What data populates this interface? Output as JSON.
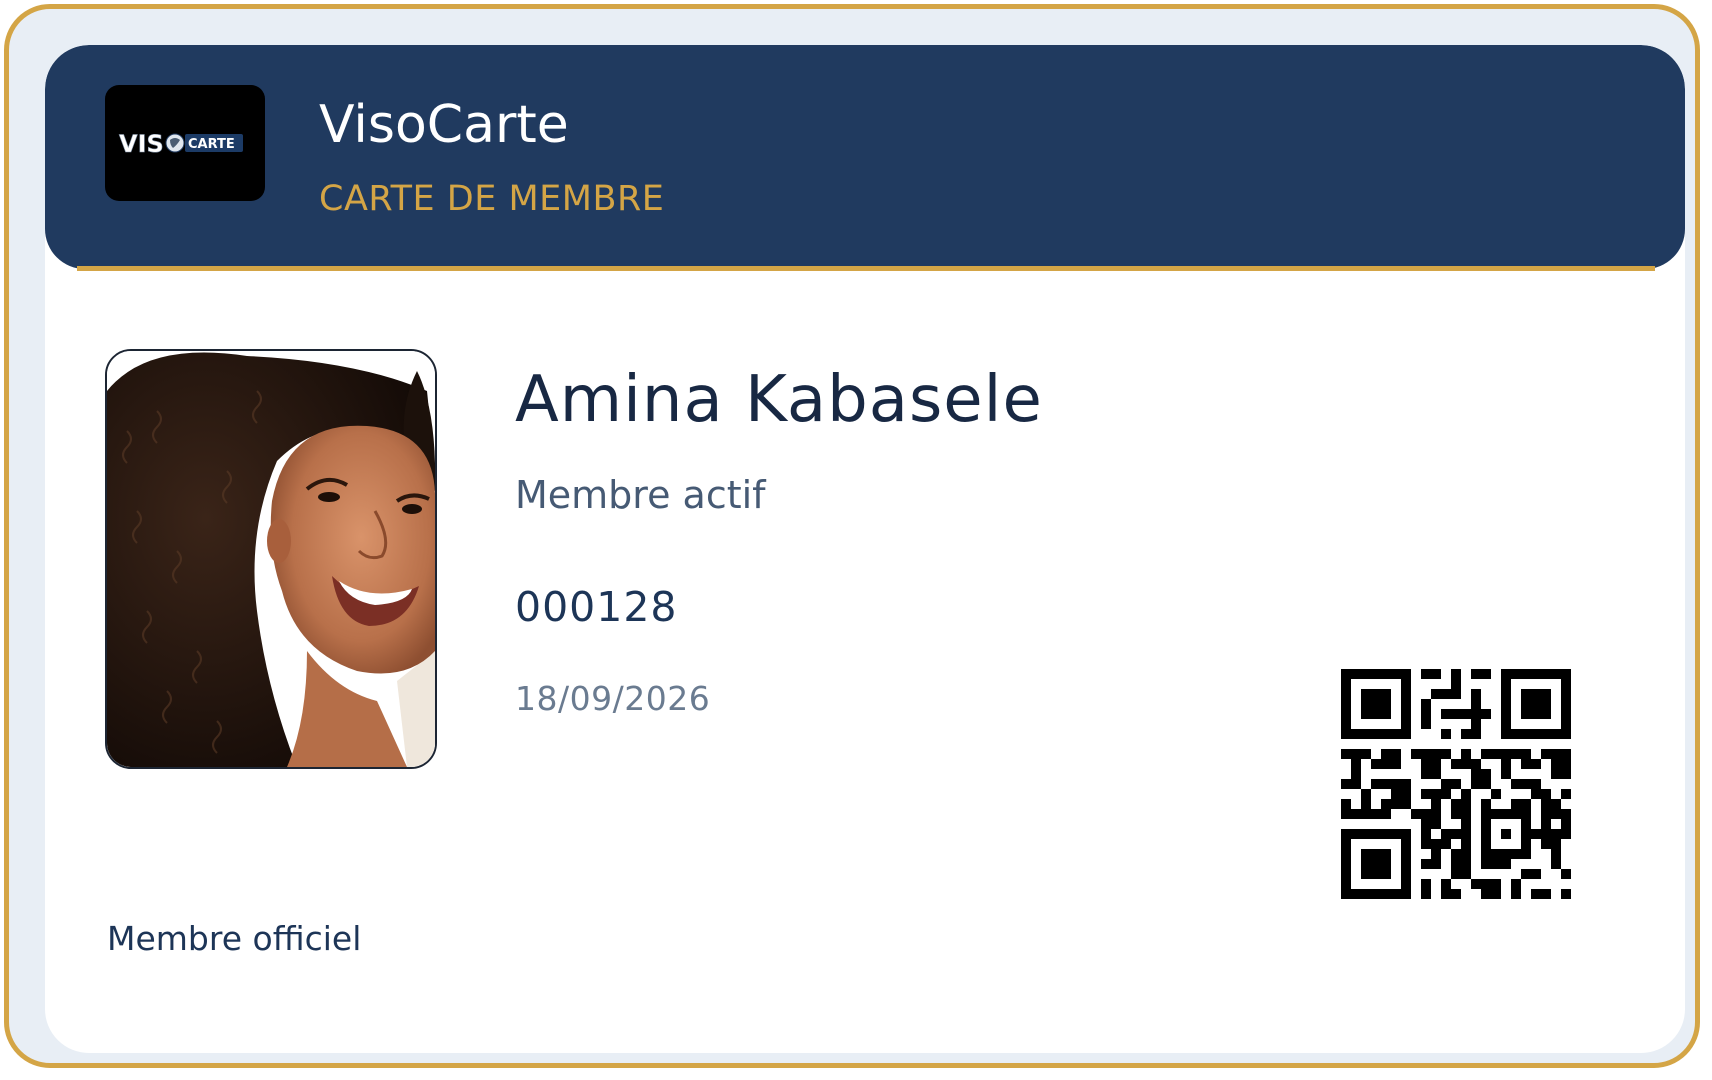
{
  "colors": {
    "accent_gold": "#d4a546",
    "header_navy": "#203a5f",
    "text_dark": "#182843",
    "text_muted": "#6a7b90",
    "frame_bg": "#e8eef5"
  },
  "header": {
    "logo": {
      "icon": "visocarte-logo-icon",
      "text_left": "VIS",
      "text_right": "CARTE"
    },
    "title": "VisoCarte",
    "subtitle": "CARTE DE MEMBRE"
  },
  "member": {
    "photo_icon": "member-portrait-photo",
    "name": "Amina Kabasele",
    "role": "Membre actif",
    "number": "000128",
    "date": "18/09/2026"
  },
  "qr": {
    "icon": "qr-code-icon"
  },
  "footer": {
    "label": "Membre officiel"
  }
}
